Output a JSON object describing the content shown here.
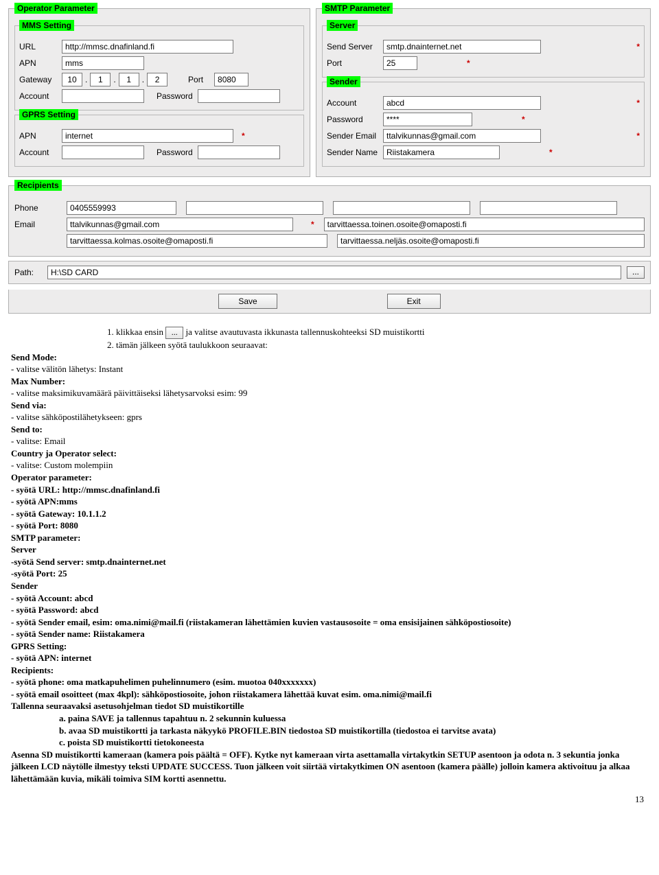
{
  "operator": {
    "title": "Operator Parameter",
    "mms": {
      "title": "MMS Setting",
      "url_label": "URL",
      "url": "http://mmsc.dnafinland.fi",
      "apn_label": "APN",
      "apn": "mms",
      "gateway_label": "Gateway",
      "gw1": "10",
      "gw2": "1",
      "gw3": "1",
      "gw4": "2",
      "port_label": "Port",
      "port": "8080",
      "account_label": "Account",
      "account": "",
      "password_label": "Password",
      "password": ""
    },
    "gprs": {
      "title": "GPRS Setting",
      "apn_label": "APN",
      "apn": "internet",
      "account_label": "Account",
      "account": "",
      "password_label": "Password",
      "password": ""
    }
  },
  "smtp": {
    "title": "SMTP Parameter",
    "server": {
      "title": "Server",
      "send_server_label": "Send Server",
      "send_server": "smtp.dnainternet.net",
      "port_label": "Port",
      "port": "25"
    },
    "sender": {
      "title": "Sender",
      "account_label": "Account",
      "account": "abcd",
      "password_label": "Password",
      "password": "****",
      "email_label": "Sender Email",
      "email": "ttalvikunnas@gmail.com",
      "name_label": "Sender Name",
      "name": "Riistakamera"
    }
  },
  "recipients": {
    "title": "Recipients",
    "phone_label": "Phone",
    "phone1": "0405559993",
    "phone2": "",
    "phone3": "",
    "phone4": "",
    "email_label": "Email",
    "email1": "ttalvikunnas@gmail.com",
    "email2": "tarvittaessa.toinen.osoite@omaposti.fi",
    "email3": "tarvittaessa.kolmas.osoite@omaposti.fi",
    "email4": "tarvittaessa.neljäs.osoite@omaposti.fi"
  },
  "path": {
    "label": "Path:",
    "value": "H:\\SD CARD",
    "browse": "..."
  },
  "buttons": {
    "save": "Save",
    "exit": "Exit"
  },
  "text": {
    "line1_pre": "1.    klikkaa ensin ",
    "line1_post": " ja valitse avautuvasta ikkunasta tallennuskohteeksi SD muistikortti",
    "line2": "2.    tämän jälkeen syötä taulukkoon seuraavat:",
    "send_mode_h": "Send Mode:",
    "send_mode_l": "- valitse välitön lähetys: Instant",
    "max_num_h": "Max Number:",
    "max_num_l": "- valitse maksimikuvamäärä päivittäiseksi lähetysarvoksi esim: 99",
    "send_via_h": "Send via:",
    "send_via_l": "- valitse sähköpostilähetykseen: gprs",
    "send_to_h": "Send to:",
    "send_to_l": "- valitse: Email",
    "country_h": "Country ja Operator select:",
    "country_l": "- valitse: Custom molempiin",
    "op_param_h": "Operator parameter:",
    "op_url": " - syötä URL: http://mmsc.dnafinland.fi",
    "op_apn": "- syötä APN:mms",
    "op_gw": "- syötä Gateway: 10.1.1.2",
    "op_port": "- syötä Port: 8080",
    "smtp_h": "SMTP parameter:",
    "server_h": "Server",
    "server_ss": "-syötä Send server: smtp.dnainternet.net",
    "server_port": "-syötä Port: 25",
    "sender_h": "Sender",
    "sender_acc": "- syötä Account: abcd",
    "sender_pw": " - syötä Password: abcd",
    "sender_email": "- syötä Sender email, esim: oma.nimi@mail.fi (riistakameran lähettämien kuvien vastausosoite = oma ensisijainen sähköpostiosoite)",
    "sender_name": "- syötä Sender name: Riistakamera",
    "gprs_h": "GPRS Setting:",
    "gprs_apn": "- syötä APN: internet",
    "recip_h": "Recipients:",
    "recip_phone": "- syötä phone: oma matkapuhelimen puhelinnumero (esim. muotoa 040xxxxxxx)",
    "recip_email": " - syötä email osoitteet (max 4kpl): sähköpostiosoite, johon riistakamera lähettää kuvat esim. oma.nimi@mail.fi",
    "tallenna_h": "Tallenna seuraavaksi asetusohjelman tiedot SD muistikortille",
    "step_a": "a.    paina SAVE ja tallennus tapahtuu n. 2 sekunnin kuluessa",
    "step_b": "b.    avaa SD muistikortti ja tarkasta näkyykö PROFILE.BIN tiedostoa SD muistikortilla (tiedostoa ei tarvitse avata)",
    "step_c": "c.    poista SD muistikortti tietokoneesta",
    "asenna": "Asenna SD muistikortti kameraan (kamera pois päältä = OFF). Kytke nyt kameraan virta asettamalla virtakytkin SETUP asentoon ja odota n. 3 sekuntia jonka jälkeen LCD näytölle ilmestyy teksti UPDATE SUCCESS. Tuon jälkeen voit siirtää virtakytkimen ON asentoon (kamera päälle) jolloin kamera aktivoituu ja alkaa lähettämään kuvia, mikäli toimiva SIM kortti asennettu.",
    "pagenum": "13"
  }
}
